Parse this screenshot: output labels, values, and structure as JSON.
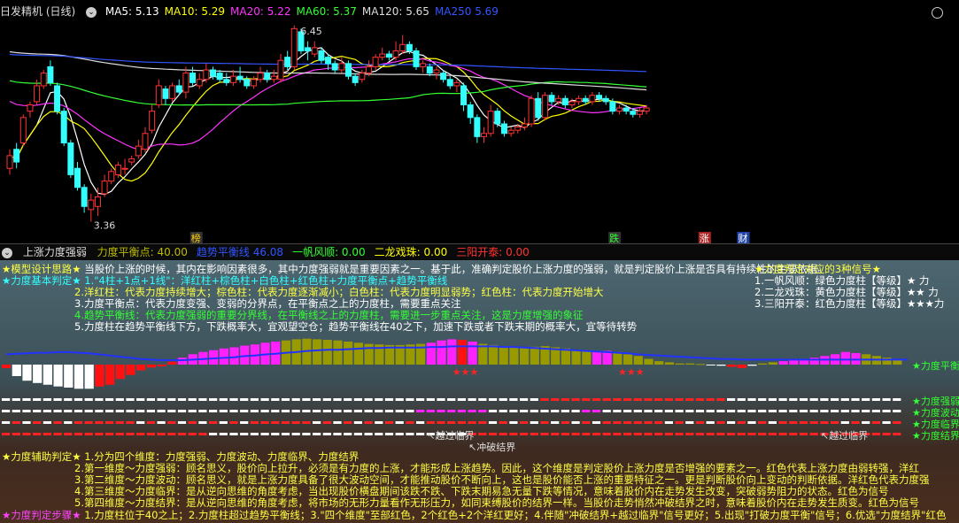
{
  "main": {
    "title": "日发精机 (日线)",
    "ma": [
      {
        "label": "MA5:",
        "value": "5.13",
        "color": "#ffffff"
      },
      {
        "label": "MA10:",
        "value": "5.29",
        "color": "#ffff00"
      },
      {
        "label": "MA20:",
        "value": "5.22",
        "color": "#ff33ff"
      },
      {
        "label": "MA60:",
        "value": "5.37",
        "color": "#33ff33"
      },
      {
        "label": "MA120:",
        "value": "5.65",
        "color": "#dddddd"
      },
      {
        "label": "MA250",
        "value": "5.69",
        "color": "#3355ff"
      }
    ],
    "high_label": "6.45",
    "low_label": "3.36",
    "event_tags": [
      {
        "text": "榜",
        "color": "#ffcc00",
        "bg": "#333"
      },
      {
        "text": "跌",
        "color": "#33ff33",
        "bg": "#333"
      },
      {
        "text": "涨",
        "color": "#ffffff",
        "bg": "#aa2222"
      },
      {
        "text": "财",
        "color": "#ffffff",
        "bg": "#2244aa"
      }
    ],
    "candles": [
      {
        "o": 4.2,
        "c": 4.4,
        "h": 4.5,
        "l": 4.1
      },
      {
        "o": 4.5,
        "c": 4.3,
        "h": 4.6,
        "l": 4.2
      },
      {
        "o": 4.6,
        "c": 5.0,
        "h": 5.05,
        "l": 4.55
      },
      {
        "o": 5.1,
        "c": 5.2,
        "h": 5.25,
        "l": 5.0
      },
      {
        "o": 5.25,
        "c": 5.5,
        "h": 5.6,
        "l": 5.2
      },
      {
        "o": 5.5,
        "c": 5.7,
        "h": 5.75,
        "l": 5.45
      },
      {
        "o": 5.8,
        "c": 5.55,
        "h": 5.9,
        "l": 5.5
      },
      {
        "o": 5.5,
        "c": 5.1,
        "h": 5.55,
        "l": 5.05
      },
      {
        "o": 5.1,
        "c": 4.6,
        "h": 5.15,
        "l": 4.55
      },
      {
        "o": 4.6,
        "c": 4.1,
        "h": 4.65,
        "l": 4.05
      },
      {
        "o": 4.2,
        "c": 3.9,
        "h": 4.3,
        "l": 3.85
      },
      {
        "o": 3.9,
        "c": 3.6,
        "h": 3.95,
        "l": 3.5
      },
      {
        "o": 3.55,
        "c": 3.7,
        "h": 3.8,
        "l": 3.36
      },
      {
        "o": 3.6,
        "c": 3.75,
        "h": 3.9,
        "l": 3.45
      },
      {
        "o": 3.8,
        "c": 4.0,
        "h": 4.1,
        "l": 3.75
      },
      {
        "o": 4.0,
        "c": 4.15,
        "h": 4.2,
        "l": 3.95
      },
      {
        "o": 4.1,
        "c": 4.25,
        "h": 4.3,
        "l": 4.05
      },
      {
        "o": 4.2,
        "c": 4.2,
        "h": 4.35,
        "l": 4.1
      },
      {
        "o": 4.3,
        "c": 4.35,
        "h": 4.4,
        "l": 4.25
      },
      {
        "o": 4.4,
        "c": 4.55,
        "h": 4.65,
        "l": 4.35
      },
      {
        "o": 4.5,
        "c": 4.75,
        "h": 4.85,
        "l": 4.45
      },
      {
        "o": 4.8,
        "c": 5.1,
        "h": 5.2,
        "l": 4.75
      },
      {
        "o": 5.2,
        "c": 5.5,
        "h": 5.6,
        "l": 5.15
      },
      {
        "o": 5.45,
        "c": 5.3,
        "h": 5.5,
        "l": 5.2
      },
      {
        "o": 5.3,
        "c": 5.5,
        "h": 5.55,
        "l": 5.25
      },
      {
        "o": 5.5,
        "c": 5.4,
        "h": 5.6,
        "l": 5.35
      },
      {
        "o": 5.4,
        "c": 5.7,
        "h": 5.8,
        "l": 5.3
      },
      {
        "o": 5.7,
        "c": 5.55,
        "h": 5.8,
        "l": 5.5
      },
      {
        "o": 5.5,
        "c": 5.6,
        "h": 5.7,
        "l": 5.45
      },
      {
        "o": 5.6,
        "c": 5.75,
        "h": 5.85,
        "l": 5.55
      },
      {
        "o": 5.75,
        "c": 5.65,
        "h": 5.8,
        "l": 5.6
      },
      {
        "o": 5.7,
        "c": 5.6,
        "h": 5.75,
        "l": 5.55
      },
      {
        "o": 5.6,
        "c": 5.55,
        "h": 5.7,
        "l": 5.5
      },
      {
        "o": 5.55,
        "c": 5.65,
        "h": 5.75,
        "l": 5.5
      },
      {
        "o": 5.65,
        "c": 5.6,
        "h": 5.8,
        "l": 5.55
      },
      {
        "o": 5.6,
        "c": 5.5,
        "h": 5.65,
        "l": 5.45
      },
      {
        "o": 5.5,
        "c": 5.6,
        "h": 5.65,
        "l": 5.45
      },
      {
        "o": 5.6,
        "c": 5.7,
        "h": 5.8,
        "l": 5.55
      },
      {
        "o": 5.7,
        "c": 5.6,
        "h": 5.75,
        "l": 5.55
      },
      {
        "o": 5.6,
        "c": 5.65,
        "h": 5.75,
        "l": 5.55
      },
      {
        "o": 5.6,
        "c": 5.9,
        "h": 6.0,
        "l": 5.55
      },
      {
        "o": 5.95,
        "c": 5.8,
        "h": 6.05,
        "l": 5.75
      },
      {
        "o": 5.8,
        "c": 6.4,
        "h": 6.45,
        "l": 5.75
      },
      {
        "o": 6.35,
        "c": 6.05,
        "h": 6.4,
        "l": 6.0
      },
      {
        "o": 6.1,
        "c": 6.05,
        "h": 6.2,
        "l": 5.9
      },
      {
        "o": 6.0,
        "c": 6.1,
        "h": 6.2,
        "l": 5.95
      },
      {
        "o": 6.05,
        "c": 5.9,
        "h": 6.1,
        "l": 5.85
      },
      {
        "o": 5.95,
        "c": 5.85,
        "h": 6.0,
        "l": 5.75
      },
      {
        "o": 5.85,
        "c": 5.75,
        "h": 5.9,
        "l": 5.7
      },
      {
        "o": 5.75,
        "c": 5.85,
        "h": 5.95,
        "l": 5.7
      },
      {
        "o": 5.85,
        "c": 5.65,
        "h": 5.9,
        "l": 5.6
      },
      {
        "o": 5.65,
        "c": 5.55,
        "h": 5.7,
        "l": 5.5
      },
      {
        "o": 5.6,
        "c": 5.7,
        "h": 5.75,
        "l": 5.55
      },
      {
        "o": 5.7,
        "c": 5.8,
        "h": 5.9,
        "l": 5.65
      },
      {
        "o": 5.8,
        "c": 5.95,
        "h": 6.0,
        "l": 5.75
      },
      {
        "o": 5.95,
        "c": 6.0,
        "h": 6.1,
        "l": 5.9
      },
      {
        "o": 6.0,
        "c": 5.95,
        "h": 6.05,
        "l": 5.9
      },
      {
        "o": 5.95,
        "c": 6.05,
        "h": 6.2,
        "l": 5.9
      },
      {
        "o": 6.05,
        "c": 6.15,
        "h": 6.3,
        "l": 6.0
      },
      {
        "o": 6.15,
        "c": 6.05,
        "h": 6.2,
        "l": 6.0
      },
      {
        "o": 6.05,
        "c": 5.8,
        "h": 6.1,
        "l": 5.75
      },
      {
        "o": 5.8,
        "c": 5.85,
        "h": 5.9,
        "l": 5.7
      },
      {
        "o": 5.8,
        "c": 5.7,
        "h": 5.85,
        "l": 5.65
      },
      {
        "o": 5.7,
        "c": 5.75,
        "h": 5.8,
        "l": 5.6
      },
      {
        "o": 5.7,
        "c": 5.6,
        "h": 5.75,
        "l": 5.55
      },
      {
        "o": 5.6,
        "c": 5.5,
        "h": 5.65,
        "l": 5.45
      },
      {
        "o": 5.5,
        "c": 5.55,
        "h": 5.6,
        "l": 5.4
      },
      {
        "o": 5.5,
        "c": 5.2,
        "h": 5.55,
        "l": 5.1
      },
      {
        "o": 5.2,
        "c": 5.0,
        "h": 5.25,
        "l": 4.9
      },
      {
        "o": 5.0,
        "c": 4.7,
        "h": 5.05,
        "l": 4.6
      },
      {
        "o": 4.7,
        "c": 4.75,
        "h": 4.85,
        "l": 4.6
      },
      {
        "o": 4.75,
        "c": 5.1,
        "h": 5.2,
        "l": 4.7
      },
      {
        "o": 5.1,
        "c": 4.9,
        "h": 5.15,
        "l": 4.85
      },
      {
        "o": 4.9,
        "c": 4.75,
        "h": 4.95,
        "l": 4.7
      },
      {
        "o": 4.75,
        "c": 4.8,
        "h": 4.85,
        "l": 4.7
      },
      {
        "o": 4.8,
        "c": 4.85,
        "h": 4.9,
        "l": 4.75
      },
      {
        "o": 4.85,
        "c": 4.9,
        "h": 5.0,
        "l": 4.8
      },
      {
        "o": 4.9,
        "c": 5.3,
        "h": 5.35,
        "l": 4.85
      },
      {
        "o": 5.3,
        "c": 5.0,
        "h": 5.4,
        "l": 4.95
      },
      {
        "o": 5.0,
        "c": 5.35,
        "h": 5.4,
        "l": 4.95
      },
      {
        "o": 5.35,
        "c": 5.25,
        "h": 5.4,
        "l": 5.2
      },
      {
        "o": 5.25,
        "c": 5.3,
        "h": 5.35,
        "l": 5.2
      },
      {
        "o": 5.3,
        "c": 5.2,
        "h": 5.35,
        "l": 5.15
      },
      {
        "o": 5.2,
        "c": 5.25,
        "h": 5.3,
        "l": 5.15
      },
      {
        "o": 5.25,
        "c": 5.3,
        "h": 5.35,
        "l": 5.2
      },
      {
        "o": 5.3,
        "c": 5.25,
        "h": 5.35,
        "l": 5.2
      },
      {
        "o": 5.25,
        "c": 5.35,
        "h": 5.4,
        "l": 5.2
      },
      {
        "o": 5.35,
        "c": 5.3,
        "h": 5.4,
        "l": 5.25
      },
      {
        "o": 5.3,
        "c": 5.25,
        "h": 5.35,
        "l": 5.2
      },
      {
        "o": 5.25,
        "c": 5.1,
        "h": 5.3,
        "l": 5.05
      },
      {
        "o": 5.1,
        "c": 5.15,
        "h": 5.2,
        "l": 5.05
      },
      {
        "o": 5.15,
        "c": 5.1,
        "h": 5.2,
        "l": 5.05
      },
      {
        "o": 5.1,
        "c": 5.05,
        "h": 5.15,
        "l": 5.0
      },
      {
        "o": 5.05,
        "c": 5.1,
        "h": 5.15,
        "l": 5.0
      },
      {
        "o": 5.1,
        "c": 5.15,
        "h": 5.2,
        "l": 5.05
      }
    ]
  },
  "indicator": {
    "name": "上涨力度强弱",
    "items": [
      {
        "label": "力度平衡点:",
        "value": "40.00",
        "color": "#bbbb00"
      },
      {
        "label": "趋势平衡线",
        "value": "46.08",
        "color": "#3355ff"
      },
      {
        "label": "一帆风顺:",
        "value": "0.00",
        "color": "#33ff33"
      },
      {
        "label": "二龙戏珠:",
        "value": "0.00",
        "color": "#ffff00"
      },
      {
        "label": "三阳开泰:",
        "value": "0.00",
        "color": "#ff3333"
      }
    ],
    "bars": [
      {
        "v": -6,
        "t": "red"
      },
      {
        "v": -20,
        "t": "white"
      },
      {
        "v": -28,
        "t": "white"
      },
      {
        "v": -32,
        "t": "white"
      },
      {
        "v": -35,
        "t": "white"
      },
      {
        "v": -38,
        "t": "white"
      },
      {
        "v": -40,
        "t": "white"
      },
      {
        "v": -42,
        "t": "white"
      },
      {
        "v": -42,
        "t": "white"
      },
      {
        "v": -38,
        "t": "red"
      },
      {
        "v": -35,
        "t": "red"
      },
      {
        "v": -25,
        "t": "red"
      },
      {
        "v": -18,
        "t": "red"
      },
      {
        "v": -10,
        "t": "red"
      },
      {
        "v": -5,
        "t": "red"
      },
      {
        "v": -3,
        "t": "red"
      },
      {
        "v": 5,
        "t": "red"
      },
      {
        "v": 12,
        "t": "mag"
      },
      {
        "v": 18,
        "t": "mag"
      },
      {
        "v": 22,
        "t": "mag"
      },
      {
        "v": 25,
        "t": "mag"
      },
      {
        "v": 28,
        "t": "mag"
      },
      {
        "v": 30,
        "t": "mag"
      },
      {
        "v": 33,
        "t": "mag"
      },
      {
        "v": 35,
        "t": "mag"
      },
      {
        "v": 38,
        "t": "mag"
      },
      {
        "v": 40,
        "t": "mag"
      },
      {
        "v": 42,
        "t": "olive"
      },
      {
        "v": 44,
        "t": "olive"
      },
      {
        "v": 45,
        "t": "olive"
      },
      {
        "v": 44,
        "t": "olive"
      },
      {
        "v": 43,
        "t": "olive"
      },
      {
        "v": 42,
        "t": "olive"
      },
      {
        "v": 40,
        "t": "olive"
      },
      {
        "v": 38,
        "t": "olive"
      },
      {
        "v": 36,
        "t": "olive"
      },
      {
        "v": 35,
        "t": "olive"
      },
      {
        "v": 34,
        "t": "olive"
      },
      {
        "v": 34,
        "t": "olive"
      },
      {
        "v": 35,
        "t": "olive"
      },
      {
        "v": 36,
        "t": "olive"
      },
      {
        "v": 38,
        "t": "mag"
      },
      {
        "v": 42,
        "t": "mag"
      },
      {
        "v": 44,
        "t": "mag"
      },
      {
        "v": 43,
        "t": "red"
      },
      {
        "v": 40,
        "t": "mag"
      },
      {
        "v": 36,
        "t": "olive"
      },
      {
        "v": 34,
        "t": "olive"
      },
      {
        "v": 32,
        "t": "olive"
      },
      {
        "v": 31,
        "t": "olive"
      },
      {
        "v": 30,
        "t": "olive"
      },
      {
        "v": 31,
        "t": "olive"
      },
      {
        "v": 32,
        "t": "olive"
      },
      {
        "v": 30,
        "t": "olive"
      },
      {
        "v": 28,
        "t": "olive"
      },
      {
        "v": 26,
        "t": "olive"
      },
      {
        "v": 24,
        "t": "olive"
      },
      {
        "v": 22,
        "t": "mag"
      },
      {
        "v": 24,
        "t": "mag"
      },
      {
        "v": 22,
        "t": "olive"
      },
      {
        "v": 18,
        "t": "olive"
      },
      {
        "v": 15,
        "t": "olive"
      },
      {
        "v": 10,
        "t": "olive"
      },
      {
        "v": 6,
        "t": "olive"
      },
      {
        "v": 4,
        "t": "olive"
      },
      {
        "v": 2,
        "t": "olive"
      },
      {
        "v": 2,
        "t": "olive"
      },
      {
        "v": 1,
        "t": "olive"
      },
      {
        "v": 0,
        "t": "white"
      },
      {
        "v": -2,
        "t": "white"
      },
      {
        "v": -4,
        "t": "red"
      },
      {
        "v": -6,
        "t": "red"
      },
      {
        "v": -2,
        "t": "white"
      },
      {
        "v": 2,
        "t": "olive"
      },
      {
        "v": 4,
        "t": "olive"
      },
      {
        "v": 6,
        "t": "mag"
      },
      {
        "v": 8,
        "t": "mag"
      },
      {
        "v": 10,
        "t": "mag"
      },
      {
        "v": 12,
        "t": "mag"
      },
      {
        "v": 15,
        "t": "mag"
      },
      {
        "v": 18,
        "t": "mag"
      },
      {
        "v": 22,
        "t": "mag"
      },
      {
        "v": 20,
        "t": "mag"
      },
      {
        "v": 18,
        "t": "olive"
      },
      {
        "v": 15,
        "t": "olive"
      },
      {
        "v": 12,
        "t": "olive"
      },
      {
        "v": 8,
        "t": "olive"
      }
    ],
    "balance_line": [
      30,
      31,
      32,
      33,
      33,
      34,
      34,
      33,
      32,
      30,
      28,
      26,
      24,
      22,
      21,
      20,
      20,
      20,
      21,
      22,
      23,
      24,
      25,
      27,
      28,
      30,
      31,
      33,
      34,
      36,
      37,
      38,
      38,
      39,
      40,
      41,
      41,
      42,
      42,
      42,
      42,
      43,
      43,
      44,
      44,
      44,
      44,
      44,
      43,
      43,
      42,
      41,
      40,
      39,
      38,
      37,
      36,
      35,
      34,
      33,
      32,
      30,
      29,
      28,
      27,
      26,
      25,
      24,
      23,
      22,
      22,
      21,
      21,
      21,
      21,
      21,
      21,
      21,
      21,
      21,
      21,
      21,
      21,
      21,
      21,
      21,
      21,
      21
    ],
    "stars": [
      {
        "bar": 44,
        "text": "★★★"
      },
      {
        "bar": 60,
        "text": "★★★"
      }
    ]
  },
  "text_block": {
    "model_line": {
      "prefix": "★模型设计思路★",
      "text": "当股价上涨的时候，其内在影响因素很多，其中力度强弱就是重要因素之一。基于此，准确判定股价上涨力度的强弱，就是判定股价上涨是否具有持续性的主要依据。"
    },
    "basic_judge": {
      "prefix": "★力度基本判定★",
      "text": "1.\"4柱+1点+1线\"：洋红柱+棕色柱+白色柱+红色柱+力度平衡点+趋势平衡线"
    },
    "basic_lines": [
      {
        "text": "2.洋红柱：代表力度持续增大；棕色柱：代表力度逐渐减小；白色柱：代表力度明显弱势；红色柱：代表力度开始增大",
        "color": "#ffff44"
      },
      {
        "text": "3.力度平衡点：代表力度变强、变弱的分界点，在平衡点之上的力度柱，需要重点关注",
        "color": "#ffffff"
      },
      {
        "text": "4.趋势平衡线：代表力度强弱的重要分界线，在平衡线之上的力度柱，需要进一步重点关注，这是力度增强的象征",
        "color": "#33ff33"
      },
      {
        "text": "5.力度柱在趋势平衡线下方，下跌概率大，宜观望空仓；趋势平衡线在40之下，加速下跌或者下跌末期的概率大，宜等待转势",
        "color": "#ffffff"
      }
    ],
    "signal_title": "★力度判定对应的3种信号★",
    "signals": [
      "1.一帆风顺：绿色力度柱【等级】★   力",
      "2.二龙戏珠：黄色力度柱【等级】★★  力",
      "3.三阳开泰：红色力度柱【等级】★★★力"
    ],
    "right_labels": [
      {
        "text": "★力度平衡",
        "color": "#33ff33"
      },
      {
        "text": "★力度强弱",
        "color": "#33ff33"
      },
      {
        "text": "★力度波动",
        "color": "#33ff33"
      },
      {
        "text": "★力度临界",
        "color": "#33ff33"
      },
      {
        "text": "★力度结界",
        "color": "#33ff33"
      }
    ],
    "crossings": [
      {
        "text": "↖越过临界",
        "bar": 39
      },
      {
        "text": "↖冲破结界",
        "bar": 43
      },
      {
        "text": "↖越过临界",
        "bar": 77
      }
    ],
    "aux_title": "★力度辅助判定★",
    "aux_intro": "1.分为四个维度：力度强弱、力度波动、力度临界、力度结界",
    "aux_lines": [
      "2.第一维度～力度强弱：顾名思义，股价向上拉升，必须是有力度的上涨，才能形成上涨趋势。因此，这个维度是判定股价上涨力度是否增强的要素之一。红色代表上涨力度由弱转强，洋红",
      "3.第二维度～力度波动：顾名思义，就是上涨力度具备了很大波动空间，才能推动股价不断向上，这也是股价能否上涨的重要特征之一。更是判断股价向上变动的判断依据。洋红色代表力度强",
      "4.第三维度～力度临界：是从逆向思维的角度考虑，当出现股价横盘期间该跌不跌、下跌末期易急无量下跌等情况，意味着股价内在走势发生改变，突破弱势阻力的状态。红色为信号",
      "5.第四维度～力度结界：是从逆向思维的角度考虑，将市场的无形力量看作无形压力，如同束缚股价的结界一样。当股价走势悄然冲破结界之时，意味着股价内在走势发生质变。红色为信号"
    ],
    "step_title": "★力度判定步骤★",
    "step_text": "1.力度柱位于40之上；2.力度柱超过趋势平衡线；3.\"四个维度\"至部红色，2个红色+2个洋红更好；4.伴随\"冲破结界+越过临界\"信号更好；5.出现\"打破力度平衡\"信号；6.优选\"力度结界\"红色"
  }
}
